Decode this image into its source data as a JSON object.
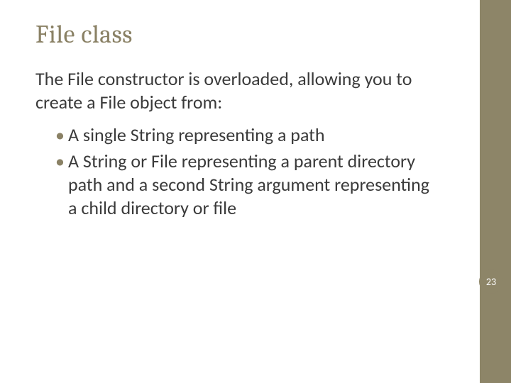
{
  "slide": {
    "title": "File  class",
    "intro": "The File constructor is overloaded, allowing you to create a File object from:",
    "bullets": [
      "A single String representing a path",
      "A String or File representing a parent directory path and a second String argument representing a child directory or file"
    ],
    "pageNumber": "23"
  },
  "colors": {
    "accent": "#8a8165",
    "sidebar": "#8d8568",
    "text": "#3a3a3a"
  }
}
